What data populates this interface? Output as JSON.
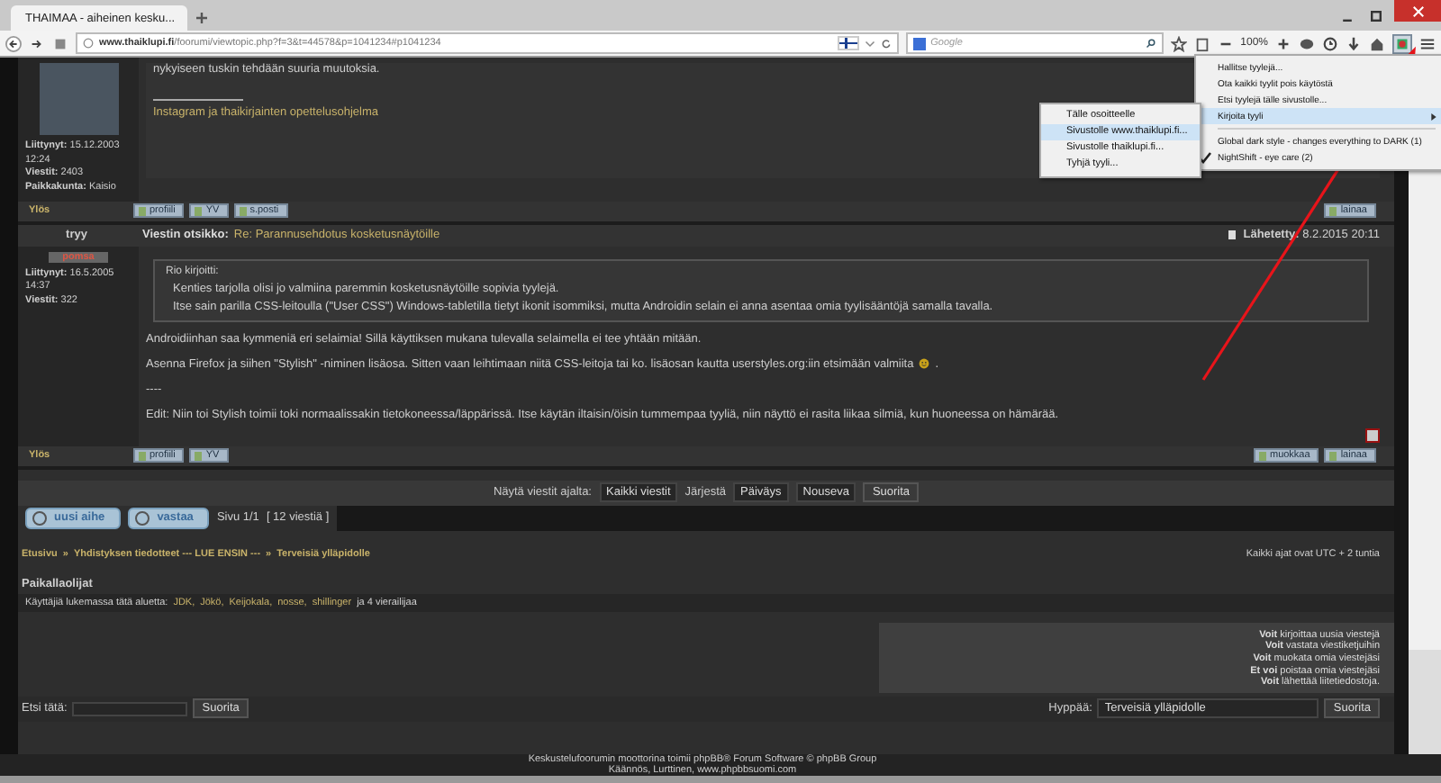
{
  "browser": {
    "tab_title": "THAIMAA - aiheinen kesku...",
    "url_host": "www.thaiklupi.fi",
    "url_path": "/foorumi/viewtopic.php?f=3&t=44578&p=1041234#p1041234",
    "search_placeholder": "Google",
    "zoom": "100%"
  },
  "posts": [
    {
      "avatar": true,
      "profile": [
        "**Liittynyt:** 15.12.2003 12:24",
        "**Viestit:** 2403",
        "**Paikkakunta:** Kaisio"
      ],
      "body": [
        {
          "text": "nykyiseen tuskin tehdään suuria muutoksia.",
          "smiley": false
        }
      ],
      "signature": "Instagram ja thaikirjainten opettelusohjelma",
      "up_link": "Ylös",
      "left_buttons": [
        "profiili",
        "YV",
        "s.posti"
      ],
      "right_buttons": [
        "lainaa"
      ],
      "top_icon": false
    },
    {
      "avatar": false,
      "author": "tryy",
      "rank": "pomsa",
      "subject_label": "Viestin otsikko:",
      "subject": "Re: Parannusehdotus kosketusnäytöille",
      "posted": "**Lähetetty:** 8.2.2015 20:11",
      "profile": [
        "**Liittynyt:** 16.5.2005 14:37",
        "**Viestit:** 322"
      ],
      "quote": {
        "title": "Rio kirjoitti:",
        "paragraphs": [
          "Kenties tarjolla olisi jo valmiina paremmin kosketusnäytöille sopivia tyylejä.",
          "Itse sain parilla CSS-leitoulla (\"User CSS\") Windows-tabletilla tietyt ikonit isommiksi, mutta Androidin selain ei anna asentaa omia tyylisääntöjä samalla tavalla."
        ]
      },
      "body": [
        {
          "text": "Androidiinhan saa kymmeniä eri selaimia! Sillä käyttiksen mukana tulevalla selaimella ei tee yhtään mitään.",
          "smiley": false
        },
        {
          "text": "Asenna Firefox ja siihen \"Stylish\" -niminen lisäosa. Sitten vaan leihtimaan niitä CSS-leitoja tai ko. lisäosan kautta userstyles.org:iin etsimään valmiita",
          "smiley": true,
          "after": "."
        },
        {
          "text": "----",
          "smiley": false
        },
        {
          "text": "Edit: Niin toi Stylish toimii toki normaalissakin tietokoneessa/läppärissä. Itse käytän iltaisin/öisin tummempaa tyyliä, niin näyttö ei rasita liikaa silmiä, kun huoneessa on hämärää.",
          "smiley": false
        }
      ],
      "up_link": "Ylös",
      "left_buttons": [
        "profiili",
        "YV"
      ],
      "right_buttons": [
        "muokkaa",
        "lainaa"
      ],
      "top_icon": true
    }
  ],
  "sort_bar": {
    "show_label": "Näytä viestit ajalta:",
    "show_value": "Kaikki viestit",
    "order_label": "Järjestä",
    "order_value": "Päiväys",
    "direction": "Nouseva",
    "button": "Suorita"
  },
  "pagination": {
    "buttons": [
      "uusi aihe",
      "vastaa"
    ],
    "page": "Sivu 1/1",
    "count": "[ 12 viestiä ]"
  },
  "breadcrumb": {
    "crumbs": [
      "Etusivu",
      "Yhdistyksen tiedotteet --- LUE ENSIN ---",
      "Terveisiä ylläpidolle"
    ],
    "separator": "»",
    "timezone": "Kaikki ajat ovat UTC + 2 tuntia"
  },
  "online": {
    "heading": "Paikallaolijat",
    "prefix": "Käyttäjiä lukemassa tätä aluetta:",
    "users": [
      "JDK,",
      "Jökö,",
      "Keijokala,",
      "nosse,",
      "shillinger"
    ],
    "suffix": "ja 4 vierailijaa"
  },
  "permissions": [
    "**Voit** kirjoittaa uusia viestejä",
    "**Voit** vastata viestiketjuihin",
    "**Voit** muokata omia viestejäsi",
    "**Et voi** poistaa omia viestejäsi",
    "**Voit** lähettää liitetiedostoja."
  ],
  "search": {
    "label": "Etsi tätä:",
    "button": "Suorita"
  },
  "jump": {
    "label": "Hyppää:",
    "value": "Terveisiä ylläpidolle",
    "button": "Suorita"
  },
  "footer": [
    "Keskustelufoorumin moottorina toimii phpBB® Forum Software © phpBB Group",
    "Käännös, Lurttinen, www.phpbbsuomi.com"
  ],
  "menu": {
    "items": [
      {
        "kind": "item",
        "label": "Hallitse tyylejä...",
        "selected": false,
        "checked": false
      },
      {
        "kind": "item",
        "label": "Ota kaikki tyylit pois käytöstä",
        "selected": false,
        "checked": false
      },
      {
        "kind": "item",
        "label": "Etsi tyylejä tälle sivustolle...",
        "selected": false,
        "checked": false
      },
      {
        "kind": "submenu",
        "label": "Kirjoita tyyli",
        "selected": true,
        "checked": false
      },
      {
        "kind": "separator"
      },
      {
        "kind": "item",
        "label": "Global dark style - changes everything to DARK (1)",
        "selected": false,
        "checked": false
      },
      {
        "kind": "item",
        "label": "NightShift - eye care (2)",
        "selected": false,
        "checked": true
      }
    ],
    "submenu": [
      {
        "label": "Tälle osoitteelle",
        "selected": false
      },
      {
        "label": "Sivustolle www.thaiklupi.fi...",
        "selected": true
      },
      {
        "label": "Sivustolle thaiklupi.fi...",
        "selected": false
      },
      {
        "label": "Tyhjä tyyli...",
        "selected": false
      }
    ]
  }
}
